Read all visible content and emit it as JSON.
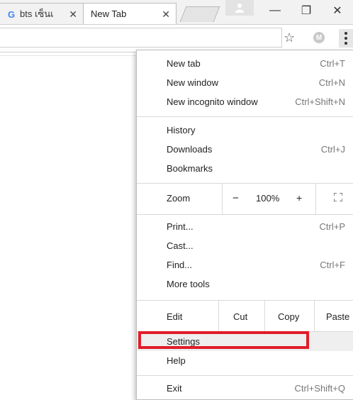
{
  "tabs": [
    {
      "label": "bts เซ็นเ",
      "icon": "google-icon",
      "close": "✕"
    },
    {
      "label": "New Tab",
      "close": "✕"
    }
  ],
  "window_controls": {
    "minimize": "—",
    "maximize": "❐",
    "close": "✕"
  },
  "toolbar": {
    "star": "☆",
    "extension_letter": "M"
  },
  "menu": {
    "items_group1": [
      {
        "label": "New tab",
        "shortcut": "Ctrl+T"
      },
      {
        "label": "New window",
        "shortcut": "Ctrl+N"
      },
      {
        "label": "New incognito window",
        "shortcut": "Ctrl+Shift+N"
      }
    ],
    "items_group2": [
      {
        "label": "History",
        "trail": "‹"
      },
      {
        "label": "Downloads",
        "shortcut": "Ctrl+J"
      },
      {
        "label": "Bookmarks",
        "trail": "‹"
      }
    ],
    "zoom": {
      "label": "Zoom",
      "minus": "−",
      "value": "100%",
      "plus": "+"
    },
    "items_group3": [
      {
        "label": "Print...",
        "shortcut": "Ctrl+P"
      },
      {
        "label": "Cast..."
      },
      {
        "label": "Find...",
        "shortcut": "Ctrl+F"
      },
      {
        "label": "More tools",
        "trail": "‹"
      }
    ],
    "edit": {
      "label": "Edit",
      "cut": "Cut",
      "copy": "Copy",
      "paste": "Paste"
    },
    "items_group4": [
      {
        "label": "Settings"
      },
      {
        "label": "Help",
        "trail": "‹"
      }
    ],
    "exit": {
      "label": "Exit",
      "shortcut": "Ctrl+Shift+Q"
    }
  },
  "colors": {
    "highlight_border": "#e01e2a",
    "menu_hover": "#efefef"
  }
}
